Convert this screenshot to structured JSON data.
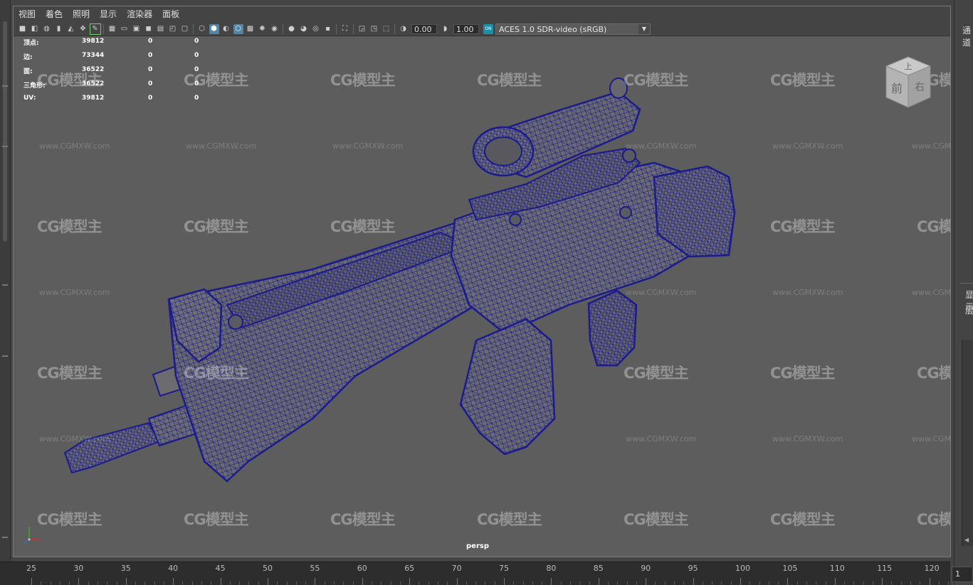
{
  "menu": [
    "视图",
    "着色",
    "照明",
    "显示",
    "渲染器",
    "面板"
  ],
  "toolbar": {
    "icons": [
      "camera-select-icon",
      "camera-lock-icon",
      "camera-attributes-icon",
      "bookmark-icon",
      "image-plane-icon",
      "grease-pencil-icon",
      "2d-pan-zoom-icon",
      "grid-icon",
      "film-gate-icon",
      "resolution-gate-icon",
      "gate-mask-icon",
      "field-chart-icon",
      "safe-action-icon",
      "safe-title-icon",
      "wireframe-icon",
      "smooth-shade-icon",
      "default-material-icon",
      "wireframe-on-shaded-icon",
      "xray-icon",
      "textured-icon",
      "use-all-lights-icon",
      "shadows-icon",
      "screen-space-ao-icon",
      "motion-blur-icon",
      "anti-aliasing-icon",
      "depth-of-field-icon",
      "isolate-select-icon",
      "xray-joints-icon",
      "xray-active-icon",
      "backface-icon",
      "camera-gate-icon"
    ],
    "exposure": "0.00",
    "gamma": "1.00",
    "ocio_badge": "ON",
    "colorspace": "ACES 1.0 SDR-video (sRGB)"
  },
  "hud": {
    "rows": [
      {
        "label": "顶点:",
        "v1": "39812",
        "v2": "0",
        "v3": "0"
      },
      {
        "label": "边:",
        "v1": "73344",
        "v2": "0",
        "v3": "0"
      },
      {
        "label": "面:",
        "v1": "36522",
        "v2": "0",
        "v3": "0"
      },
      {
        "label": "三角形:",
        "v1": "36522",
        "v2": "0",
        "v3": "0"
      },
      {
        "label": "UV:",
        "v1": "39812",
        "v2": "0",
        "v3": "0"
      }
    ]
  },
  "watermark": {
    "logo": "CG模型主",
    "url": "www.CGMXW.com"
  },
  "viewcube": {
    "top": "上",
    "front": "前",
    "right": "右"
  },
  "camera_name": "persp",
  "timeline": {
    "labels": [
      "25",
      "30",
      "35",
      "40",
      "45",
      "50",
      "55",
      "60",
      "65",
      "70",
      "75",
      "80",
      "85",
      "90",
      "95",
      "100",
      "105",
      "110",
      "115",
      "120"
    ]
  },
  "right_panel": {
    "top": "通道",
    "item_a": "显示",
    "item_b": "层"
  },
  "current_frame": "1",
  "colors": {
    "wire": "#1b1b8c",
    "mesh_fill": "#6a6a70",
    "viewport_bg": "#5d5d5d",
    "accent": "#5285a6"
  }
}
